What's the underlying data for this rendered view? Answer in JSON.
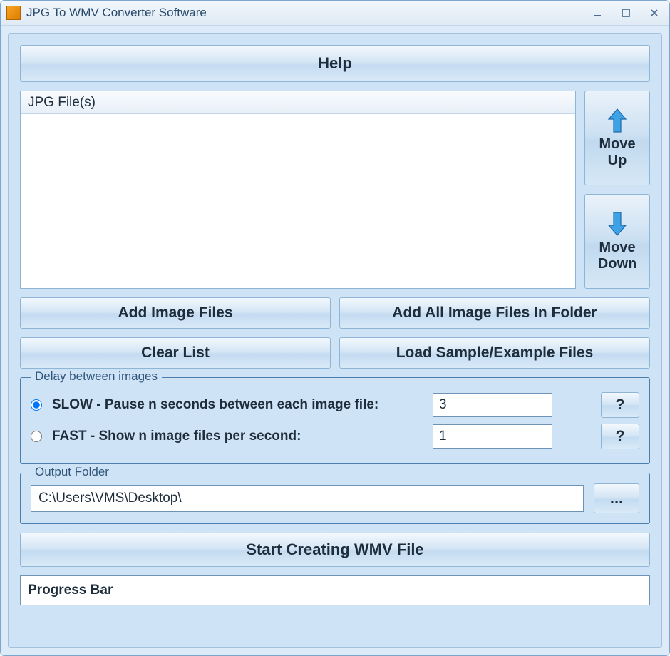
{
  "window": {
    "title": "JPG To WMV Converter Software"
  },
  "help": {
    "label": "Help"
  },
  "file_list": {
    "header": "JPG File(s)"
  },
  "move": {
    "up": "Move Up",
    "down": "Move Down"
  },
  "buttons": {
    "add_files": "Add Image Files",
    "add_folder": "Add All Image Files In Folder",
    "clear": "Clear List",
    "load_sample": "Load Sample/Example Files"
  },
  "delay": {
    "legend": "Delay between images",
    "slow_label": "SLOW - Pause n seconds between each image file:",
    "slow_value": "3",
    "fast_label": "FAST - Show n image files per second:",
    "fast_value": "1",
    "help_label": "?",
    "selected": "slow"
  },
  "output": {
    "legend": "Output Folder",
    "path": "C:\\Users\\VMS\\Desktop\\",
    "browse": "..."
  },
  "start": {
    "label": "Start Creating WMV File"
  },
  "progress": {
    "label": "Progress Bar"
  }
}
